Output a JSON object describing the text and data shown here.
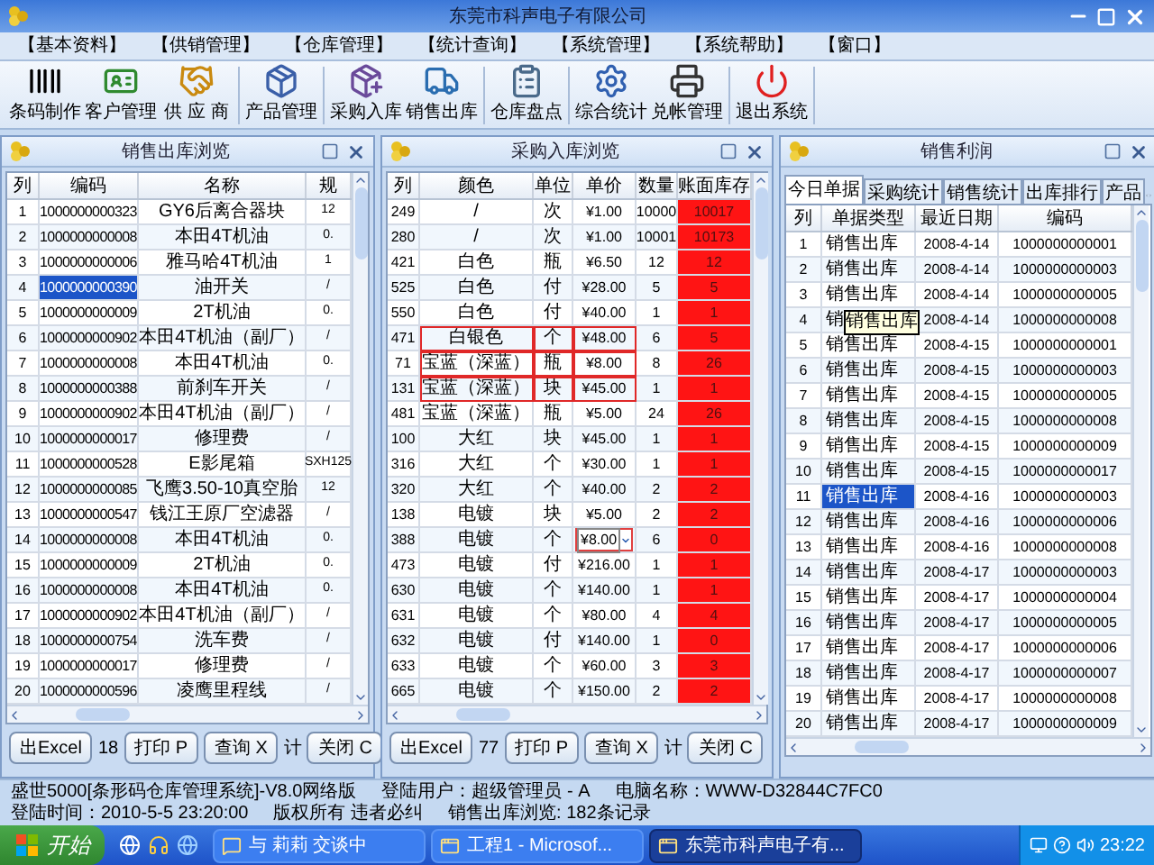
{
  "window": {
    "title": "东莞市科声电子有限公司"
  },
  "menu": [
    "【基本资料】",
    "【供销管理】",
    "【仓库管理】",
    "【统计查询】",
    "【系统管理】",
    "【系统帮助】",
    "【窗口】"
  ],
  "toolbar": [
    {
      "label": "条码制作",
      "separator_after": false
    },
    {
      "label": "客户管理",
      "separator_after": false
    },
    {
      "label": "供 应 商",
      "separator_after": true
    },
    {
      "label": "产品管理",
      "separator_after": true
    },
    {
      "label": "采购入库",
      "separator_after": false
    },
    {
      "label": "销售出库",
      "separator_after": true
    },
    {
      "label": "仓库盘点",
      "separator_after": true
    },
    {
      "label": "综合统计",
      "separator_after": false
    },
    {
      "label": "兑帐管理",
      "separator_after": true
    },
    {
      "label": "退出系统",
      "separator_after": true
    }
  ],
  "left_panel": {
    "title": "销售出库浏览",
    "columns": [
      "列",
      "编码",
      "名称",
      "规"
    ],
    "rows": [
      {
        "cells": [
          "1",
          "1000000000323",
          "GY6后离合器块",
          "12"
        ],
        "selected": false
      },
      {
        "cells": [
          "2",
          "1000000000008",
          "本田4T机油",
          "0."
        ],
        "selected": false
      },
      {
        "cells": [
          "3",
          "1000000000006",
          "雅马哈4T机油",
          "1"
        ],
        "selected": false
      },
      {
        "cells": [
          "4",
          "1000000000390",
          "油开关",
          "/"
        ],
        "selected": true
      },
      {
        "cells": [
          "5",
          "1000000000009",
          "2T机油",
          "0."
        ],
        "selected": false
      },
      {
        "cells": [
          "6",
          "1000000000902",
          "本田4T机油（副厂）",
          "/"
        ],
        "selected": false
      },
      {
        "cells": [
          "7",
          "1000000000008",
          "本田4T机油",
          "0."
        ],
        "selected": false
      },
      {
        "cells": [
          "8",
          "1000000000388",
          "前刹车开关",
          "/"
        ],
        "selected": false
      },
      {
        "cells": [
          "9",
          "1000000000902",
          "本田4T机油（副厂）",
          "/"
        ],
        "selected": false
      },
      {
        "cells": [
          "10",
          "1000000000017",
          "修理费",
          "/"
        ],
        "selected": false
      },
      {
        "cells": [
          "11",
          "1000000000528",
          "E影尾箱",
          "SXH125"
        ],
        "selected": false
      },
      {
        "cells": [
          "12",
          "1000000000085",
          "飞鹰3.50-10真空胎",
          "12"
        ],
        "selected": false
      },
      {
        "cells": [
          "13",
          "1000000000547",
          "钱江王原厂空滤器",
          "/"
        ],
        "selected": false
      },
      {
        "cells": [
          "14",
          "1000000000008",
          "本田4T机油",
          "0."
        ],
        "selected": false
      },
      {
        "cells": [
          "15",
          "1000000000009",
          "2T机油",
          "0."
        ],
        "selected": false
      },
      {
        "cells": [
          "16",
          "1000000000008",
          "本田4T机油",
          "0."
        ],
        "selected": false
      },
      {
        "cells": [
          "17",
          "1000000000902",
          "本田4T机油（副厂）",
          "/"
        ],
        "selected": false
      },
      {
        "cells": [
          "18",
          "1000000000754",
          "洗车费",
          "/"
        ],
        "selected": false
      },
      {
        "cells": [
          "19",
          "1000000000017",
          "修理费",
          "/"
        ],
        "selected": false
      },
      {
        "cells": [
          "20",
          "1000000000596",
          "凌鹰里程线",
          "/"
        ],
        "selected": false
      }
    ],
    "buttons": [
      {
        "kind": "button",
        "label": "出Excel"
      },
      {
        "kind": "text",
        "label": "18"
      },
      {
        "kind": "button",
        "label": "打印 P"
      },
      {
        "kind": "button",
        "label": "查询 X"
      },
      {
        "kind": "text",
        "label": "计"
      },
      {
        "kind": "button",
        "label": "关闭 C"
      }
    ]
  },
  "middle_panel": {
    "title": "采购入库浏览",
    "columns": [
      "列",
      "颜色",
      "单位",
      "单价",
      "数量",
      "账面库存"
    ],
    "rows": [
      {
        "cells": [
          "249",
          "/",
          "次",
          "¥1.00",
          "10000",
          "10017"
        ],
        "marked": false,
        "editing": false,
        "alert": true
      },
      {
        "cells": [
          "280",
          "/",
          "次",
          "¥1.00",
          "10001",
          "10173"
        ],
        "marked": false,
        "editing": false,
        "alert": true
      },
      {
        "cells": [
          "421",
          "白色",
          "瓶",
          "¥6.50",
          "12",
          "12"
        ],
        "marked": false,
        "editing": false,
        "alert": true
      },
      {
        "cells": [
          "525",
          "白色",
          "付",
          "¥28.00",
          "5",
          "5"
        ],
        "marked": false,
        "editing": false,
        "alert": true
      },
      {
        "cells": [
          "550",
          "白色",
          "付",
          "¥40.00",
          "1",
          "1"
        ],
        "marked": false,
        "editing": false,
        "alert": true
      },
      {
        "cells": [
          "471",
          "白银色",
          "个",
          "¥48.00",
          "6",
          "5"
        ],
        "marked": true,
        "editing": false,
        "alert": true
      },
      {
        "cells": [
          "71",
          "宝蓝（深蓝）",
          "瓶",
          "¥8.00",
          "8",
          "26"
        ],
        "marked": true,
        "editing": false,
        "alert": true
      },
      {
        "cells": [
          "131",
          "宝蓝（深蓝）",
          "块",
          "¥45.00",
          "1",
          "1"
        ],
        "marked": true,
        "editing": false,
        "alert": true
      },
      {
        "cells": [
          "481",
          "宝蓝（深蓝）",
          "瓶",
          "¥5.00",
          "24",
          "26"
        ],
        "marked": false,
        "editing": false,
        "alert": true
      },
      {
        "cells": [
          "100",
          "大红",
          "块",
          "¥45.00",
          "1",
          "1"
        ],
        "marked": false,
        "editing": false,
        "alert": true
      },
      {
        "cells": [
          "316",
          "大红",
          "个",
          "¥30.00",
          "1",
          "1"
        ],
        "marked": false,
        "editing": false,
        "alert": true
      },
      {
        "cells": [
          "320",
          "大红",
          "个",
          "¥40.00",
          "2",
          "2"
        ],
        "marked": false,
        "editing": false,
        "alert": true
      },
      {
        "cells": [
          "138",
          "电镀",
          "块",
          "¥5.00",
          "2",
          "2"
        ],
        "marked": false,
        "editing": false,
        "alert": true
      },
      {
        "cells": [
          "388",
          "电镀",
          "个",
          "¥8.00",
          "6",
          "0"
        ],
        "marked": false,
        "editing": true,
        "alert": true
      },
      {
        "cells": [
          "473",
          "电镀",
          "付",
          "¥216.00",
          "1",
          "1"
        ],
        "marked": false,
        "editing": false,
        "alert": true
      },
      {
        "cells": [
          "630",
          "电镀",
          "个",
          "¥140.00",
          "1",
          "1"
        ],
        "marked": false,
        "editing": false,
        "alert": true
      },
      {
        "cells": [
          "631",
          "电镀",
          "个",
          "¥80.00",
          "4",
          "4"
        ],
        "marked": false,
        "editing": false,
        "alert": true
      },
      {
        "cells": [
          "632",
          "电镀",
          "付",
          "¥140.00",
          "1",
          "0"
        ],
        "marked": false,
        "editing": false,
        "alert": true
      },
      {
        "cells": [
          "633",
          "电镀",
          "个",
          "¥60.00",
          "3",
          "3"
        ],
        "marked": false,
        "editing": false,
        "alert": true
      },
      {
        "cells": [
          "665",
          "电镀",
          "个",
          "¥150.00",
          "2",
          "2"
        ],
        "marked": false,
        "editing": false,
        "alert": true
      }
    ],
    "buttons": [
      {
        "kind": "button",
        "label": "出Excel"
      },
      {
        "kind": "text",
        "label": "77"
      },
      {
        "kind": "button",
        "label": "打印 P"
      },
      {
        "kind": "button",
        "label": "查询 X"
      },
      {
        "kind": "text",
        "label": "计"
      },
      {
        "kind": "button",
        "label": "关闭 C"
      }
    ]
  },
  "right_panel": {
    "title": "销售利润",
    "tabs": [
      {
        "label": "今日单据",
        "selected": true
      },
      {
        "label": "采购统计",
        "selected": false
      },
      {
        "label": "销售统计",
        "selected": false
      },
      {
        "label": "出库排行",
        "selected": false
      },
      {
        "label": "产品",
        "selected": false
      }
    ],
    "columns": [
      "列",
      "单据类型",
      "最近日期",
      "编码"
    ],
    "tooltip": "销售出库",
    "rows": [
      {
        "cells": [
          "1",
          "销售出库",
          "2008-4-14",
          "1000000000001"
        ],
        "selected": false
      },
      {
        "cells": [
          "2",
          "销售出库",
          "2008-4-14",
          "1000000000003"
        ],
        "selected": false
      },
      {
        "cells": [
          "3",
          "销售出库",
          "2008-4-14",
          "1000000000005"
        ],
        "selected": false
      },
      {
        "cells": [
          "4",
          "销",
          "2008-4-14",
          "1000000000008"
        ],
        "selected": false
      },
      {
        "cells": [
          "5",
          "销售出库",
          "2008-4-15",
          "1000000000001"
        ],
        "selected": false
      },
      {
        "cells": [
          "6",
          "销售出库",
          "2008-4-15",
          "1000000000003"
        ],
        "selected": false
      },
      {
        "cells": [
          "7",
          "销售出库",
          "2008-4-15",
          "1000000000005"
        ],
        "selected": false
      },
      {
        "cells": [
          "8",
          "销售出库",
          "2008-4-15",
          "1000000000008"
        ],
        "selected": false
      },
      {
        "cells": [
          "9",
          "销售出库",
          "2008-4-15",
          "1000000000009"
        ],
        "selected": false
      },
      {
        "cells": [
          "10",
          "销售出库",
          "2008-4-15",
          "1000000000017"
        ],
        "selected": false
      },
      {
        "cells": [
          "11",
          "销售出库",
          "2008-4-16",
          "1000000000003"
        ],
        "selected": true
      },
      {
        "cells": [
          "12",
          "销售出库",
          "2008-4-16",
          "1000000000006"
        ],
        "selected": false
      },
      {
        "cells": [
          "13",
          "销售出库",
          "2008-4-16",
          "1000000000008"
        ],
        "selected": false
      },
      {
        "cells": [
          "14",
          "销售出库",
          "2008-4-17",
          "1000000000003"
        ],
        "selected": false
      },
      {
        "cells": [
          "15",
          "销售出库",
          "2008-4-17",
          "1000000000004"
        ],
        "selected": false
      },
      {
        "cells": [
          "16",
          "销售出库",
          "2008-4-17",
          "1000000000005"
        ],
        "selected": false
      },
      {
        "cells": [
          "17",
          "销售出库",
          "2008-4-17",
          "1000000000006"
        ],
        "selected": false
      },
      {
        "cells": [
          "18",
          "销售出库",
          "2008-4-17",
          "1000000000007"
        ],
        "selected": false
      },
      {
        "cells": [
          "19",
          "销售出库",
          "2008-4-17",
          "1000000000008"
        ],
        "selected": false
      },
      {
        "cells": [
          "20",
          "销售出库",
          "2008-4-17",
          "1000000000009"
        ],
        "selected": false
      }
    ]
  },
  "status_bar": [
    "盛世5000[条形码仓库管理系统]-V8.0网络版",
    "登陆用户：超级管理员 - A",
    "电脑名称：WWW-D32844C7FC0",
    "登陆时间：2010-5-5 23:20:00",
    "版权所有 违者必纠",
    "销售出库浏览: 182条记录"
  ],
  "taskbar": {
    "start": "开始",
    "tasks": [
      {
        "label": "与 莉莉 交谈中",
        "active": false
      },
      {
        "label": "工程1 - Microsof...",
        "active": false
      },
      {
        "label": "东莞市科声电子有...",
        "active": true
      }
    ],
    "clock": "23:22"
  }
}
